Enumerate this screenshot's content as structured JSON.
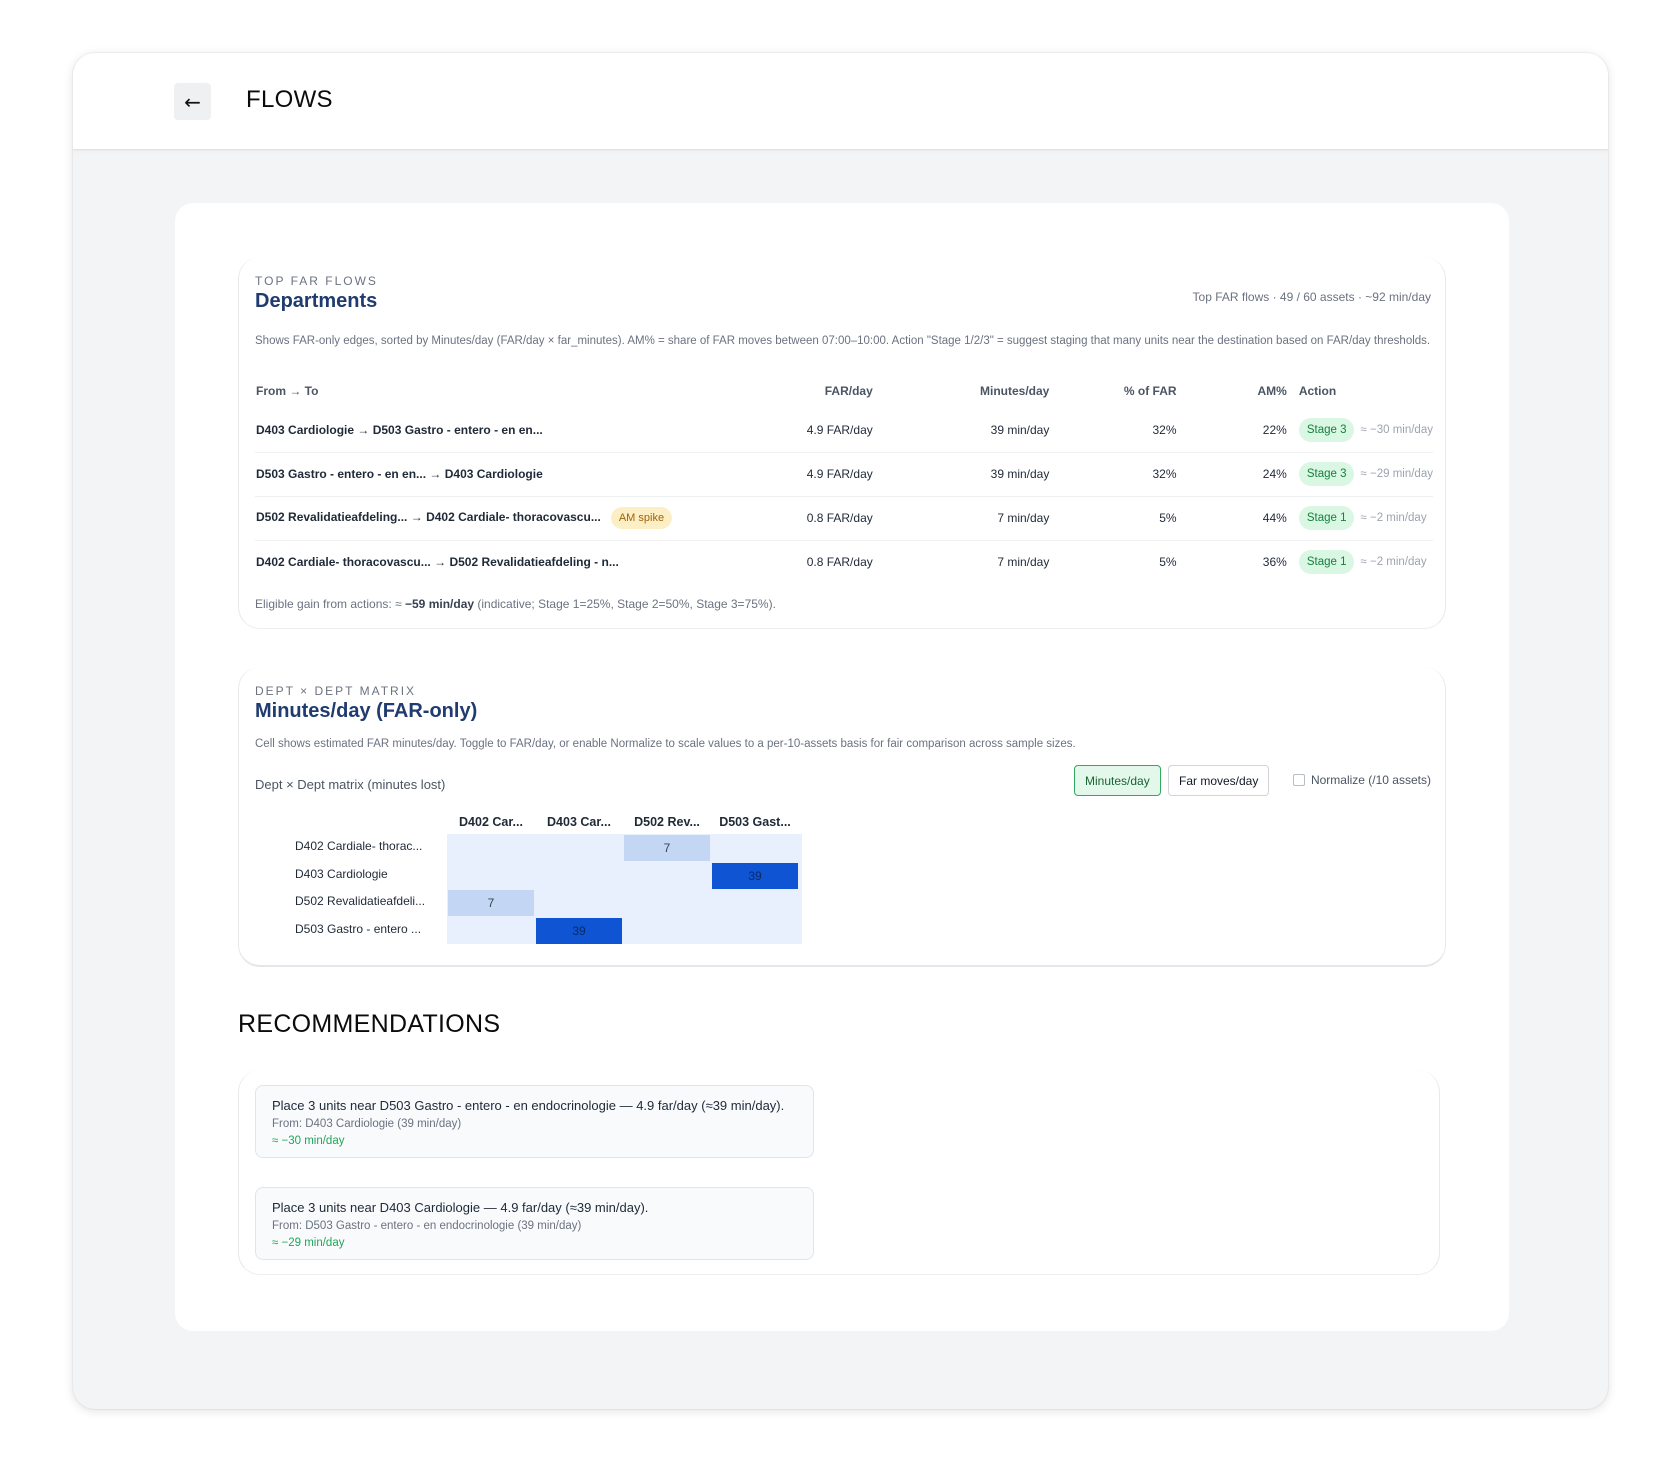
{
  "header": {
    "back_icon": "←",
    "title": "FLOWS"
  },
  "top_flows": {
    "eyebrow": "TOP FAR FLOWS",
    "heading": "Departments",
    "summary": "Top FAR flows · 49 / 60 assets · ~92 min/day",
    "description": "Shows FAR-only edges, sorted by Minutes/day (FAR/day × far_minutes). AM% = share of FAR moves between 07:00–10:00. Action \"Stage 1/2/3\" = suggest staging that many units near the destination based on FAR/day thresholds.",
    "columns": {
      "from_to": "From → To",
      "far_day": "FAR/day",
      "minutes_day": "Minutes/day",
      "pct_far": "% of FAR",
      "am_pct": "AM%",
      "action": "Action"
    },
    "rows": [
      {
        "from": "D403 Cardiologie",
        "to": "D503 Gastro - entero - en en...",
        "badge": "",
        "far_day": "4.9 FAR/day",
        "minutes_day": "39 min/day",
        "pct_far": "32%",
        "am_pct": "22%",
        "stage": "Stage 3",
        "gain": "≈ −30 min/day"
      },
      {
        "from": "D503 Gastro - entero - en en...",
        "to": "D403 Cardiologie",
        "badge": "",
        "far_day": "4.9 FAR/day",
        "minutes_day": "39 min/day",
        "pct_far": "32%",
        "am_pct": "24%",
        "stage": "Stage 3",
        "gain": "≈ −29 min/day"
      },
      {
        "from": "D502 Revalidatieafdeling...",
        "to": "D402 Cardiale- thoracovascu...",
        "badge": "AM spike",
        "far_day": "0.8 FAR/day",
        "minutes_day": "7 min/day",
        "pct_far": "5%",
        "am_pct": "44%",
        "stage": "Stage 1",
        "gain": "≈ −2 min/day"
      },
      {
        "from": "D402 Cardiale- thoracovascu...",
        "to": "D502 Revalidatieafdeling - n...",
        "badge": "",
        "far_day": "0.8 FAR/day",
        "minutes_day": "7 min/day",
        "pct_far": "5%",
        "am_pct": "36%",
        "stage": "Stage 1",
        "gain": "≈ −2 min/day"
      }
    ],
    "eligible_prefix": "Eligible gain from actions: ≈ ",
    "eligible_value": "−59 min/day",
    "eligible_suffix": " (indicative; Stage 1=25%, Stage 2=50%, Stage 3=75%)."
  },
  "matrix": {
    "eyebrow": "DEPT × DEPT MATRIX",
    "heading": "Minutes/day (FAR-only)",
    "description": "Cell shows estimated FAR minutes/day. Toggle to FAR/day, or enable Normalize to scale values to a per-10-assets basis for fair comparison across sample sizes.",
    "label": "Dept × Dept matrix (minutes lost)",
    "toggle_minutes": "Minutes/day",
    "toggle_moves": "Far moves/day",
    "normalize_label": "Normalize (/10 assets)",
    "normalize_checked": false,
    "active_toggle": "Minutes/day",
    "col_headers": [
      "D402 Car...",
      "D403 Car...",
      "D502 Rev...",
      "D503 Gast..."
    ],
    "row_headers": [
      "D402 Cardiale- thorac...",
      "D403 Cardiologie",
      "D502 Revalidatieafdeli...",
      "D503 Gastro - entero ..."
    ],
    "cells": [
      {
        "row": 0,
        "col": 2,
        "value": "7"
      },
      {
        "row": 1,
        "col": 3,
        "value": "39"
      },
      {
        "row": 2,
        "col": 0,
        "value": "7"
      },
      {
        "row": 3,
        "col": 1,
        "value": "39"
      }
    ],
    "colors": {
      "empty": "#e8f0fd",
      "low": "#c3d6f4",
      "high": "#0f54d3"
    }
  },
  "recommendations": {
    "title": "RECOMMENDATIONS",
    "items": [
      {
        "main": "Place 3 units near D503 Gastro - entero - en endocrinologie — 4.9 far/day (≈39 min/day).",
        "from": "From: D403 Cardiologie (39 min/day)",
        "gain": "≈ −30 min/day"
      },
      {
        "main": "Place 3 units near D403 Cardiologie — 4.9 far/day (≈39 min/day).",
        "from": "From: D503 Gastro - entero - en endocrinologie (39 min/day)",
        "gain": "≈ −29 min/day"
      }
    ]
  }
}
